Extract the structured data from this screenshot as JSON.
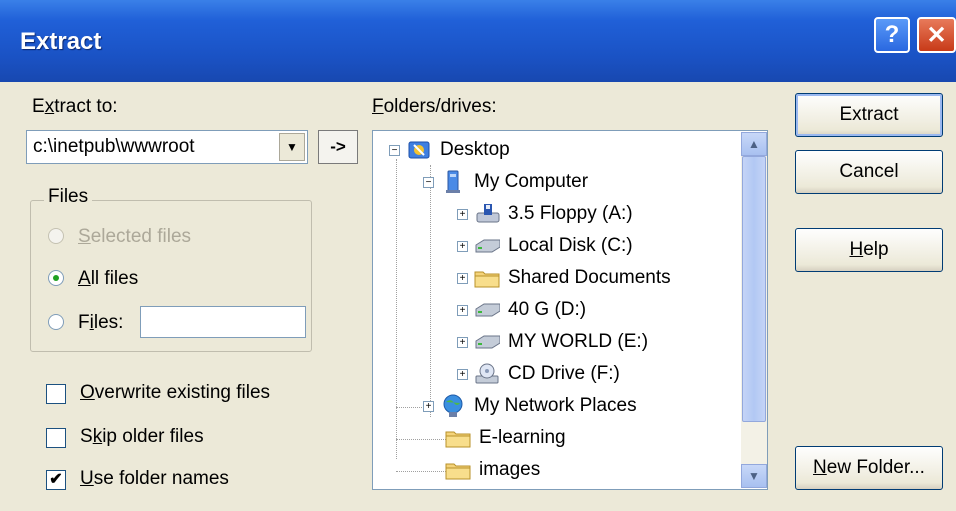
{
  "window": {
    "title": "Extract"
  },
  "title_buttons": {
    "help": "?",
    "close": "✕"
  },
  "extract_to": {
    "label_pre": "E",
    "label_u": "x",
    "label_post": "tract to:",
    "value": "c:\\inetpub\\wwwroot",
    "arrow_label": "->"
  },
  "files_group": {
    "title": "Files",
    "selected_files": {
      "u": "S",
      "rest": "elected files",
      "enabled": false,
      "selected": false
    },
    "all_files": {
      "u": "A",
      "rest": "ll files",
      "enabled": true,
      "selected": true
    },
    "files": {
      "pre": "F",
      "u": "i",
      "rest": "les:",
      "value": "",
      "enabled": true,
      "selected": false
    }
  },
  "options": {
    "overwrite": {
      "u": "O",
      "rest": "verwrite existing files",
      "checked": false
    },
    "skip_older": {
      "pre": "S",
      "u": "k",
      "rest": "ip older files",
      "checked": false
    },
    "use_folder_names": {
      "u": "U",
      "rest": "se folder names",
      "checked": true
    }
  },
  "folders": {
    "label_u": "F",
    "label_rest": "olders/drives:",
    "tree": [
      {
        "label": "Desktop",
        "icon": "desktop-icon",
        "expander": "−"
      },
      {
        "label": "My Computer",
        "icon": "computer-icon",
        "expander": "−"
      },
      {
        "label": "3.5 Floppy (A:)",
        "icon": "floppy-icon",
        "expander": "+"
      },
      {
        "label": "Local Disk (C:)",
        "icon": "hard-disk-icon",
        "expander": "+"
      },
      {
        "label": "Shared Documents",
        "icon": "folder-icon",
        "expander": "+"
      },
      {
        "label": "40 G (D:)",
        "icon": "hard-disk-icon",
        "expander": "+"
      },
      {
        "label": "MY WORLD (E:)",
        "icon": "hard-disk-icon",
        "expander": "+"
      },
      {
        "label": "CD Drive (F:)",
        "icon": "cd-drive-icon",
        "expander": "+"
      },
      {
        "label": "My Network Places",
        "icon": "network-icon",
        "expander": "+"
      },
      {
        "label": "E-learning",
        "icon": "folder-icon",
        "expander": ""
      },
      {
        "label": "images",
        "icon": "folder-icon",
        "expander": ""
      }
    ]
  },
  "buttons": {
    "extract": "Extract",
    "cancel": "Cancel",
    "help_u": "H",
    "help_rest": "elp",
    "new_folder_u": "N",
    "new_folder_rest": "ew Folder..."
  },
  "colors": {
    "titlebar": "#1a52c4",
    "face": "#ece9d8",
    "radio_dot": "#21a121"
  }
}
